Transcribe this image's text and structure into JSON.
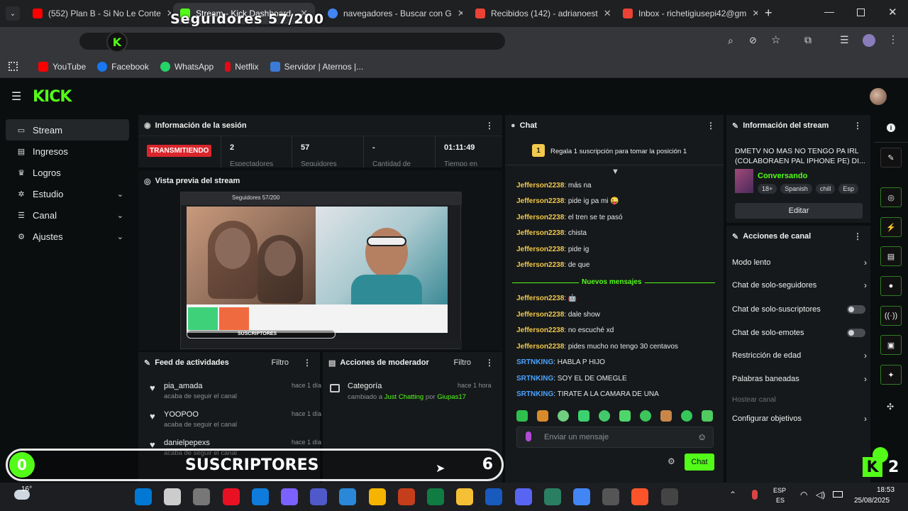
{
  "browser": {
    "tabs": [
      {
        "label": "(552) Plan B - Si No Le Conte",
        "color": "#ff0000"
      },
      {
        "label": "Stream - Kick Dashboard",
        "color": "#53fc18"
      },
      {
        "label": "navegadores - Buscar con G",
        "color": "#4285f4"
      },
      {
        "label": "Recibidos (142) - adrianoest",
        "color": "#ea4335"
      },
      {
        "label": "Inbox - richetigiusepi42@gm",
        "color": "#ea4335"
      }
    ],
    "bookmarks": [
      {
        "label": "YouTube",
        "color": "#ff0000"
      },
      {
        "label": "Facebook",
        "color": "#1877f2"
      },
      {
        "label": "WhatsApp",
        "color": "#25d366"
      },
      {
        "label": "Netflix",
        "color": "#e50914"
      },
      {
        "label": "Servidor | Aternos |...",
        "color": "#3b7bd8"
      }
    ]
  },
  "overlay": {
    "followers": "Seguidores 57/200",
    "subs_label": "SUSCRIPTORES",
    "subs_current": "0",
    "subs_goal": "6",
    "kick_count": "2"
  },
  "kick": {
    "logo": "KICK",
    "sidebar": [
      {
        "label": "Stream",
        "icon": "▭"
      },
      {
        "label": "Ingresos",
        "icon": "▤"
      },
      {
        "label": "Logros",
        "icon": "🏆"
      },
      {
        "label": "Estudio",
        "icon": "⚙"
      },
      {
        "label": "Canal",
        "icon": "☰"
      },
      {
        "label": "Ajustes",
        "icon": "⚙"
      }
    ],
    "session": {
      "title": "Información de la sesión",
      "live": "TRANSMITIENDO",
      "stats": [
        {
          "value": "2",
          "label": "Espectadores"
        },
        {
          "value": "57",
          "label": "Seguidores"
        },
        {
          "value": "-",
          "label": "Cantidad de"
        },
        {
          "value": "01:11:49",
          "label": "Tiempo en"
        }
      ]
    },
    "preview_title": "Vista previa del stream",
    "preview_inner_title": "Seguidores 57/200",
    "preview_subs": "SUSCRIPTORES",
    "feed": {
      "title": "Feed de actividades",
      "filter": "Filtro",
      "items": [
        {
          "name": "pia_amada",
          "sub": "acaba de seguir el canal",
          "time": "hace 1 día"
        },
        {
          "name": "YOOPOO",
          "sub": "acaba de seguir el canal",
          "time": "hace 1 día"
        },
        {
          "name": "danielpepexs",
          "sub": "acaba de seguir el canal",
          "time": "hace 1 día"
        }
      ]
    },
    "mod": {
      "title": "Acciones de moderador",
      "filter": "Filtro",
      "item": {
        "name": "Categoría",
        "pre": "cambiado a",
        "cat": "Just Chatting",
        "by": "por",
        "user": "Giupas17",
        "time": "hace 1 hora"
      }
    },
    "chat": {
      "title": "Chat",
      "promo": "Regala 1 suscripción para tomar la posición 1",
      "messages": [
        {
          "user": "Jefferson2238",
          "text": "más na"
        },
        {
          "user": "Jefferson2238",
          "text": "pide ig pa mi 😜"
        },
        {
          "user": "Jefferson2238",
          "text": "el tren se te pasó"
        },
        {
          "user": "Jefferson2238",
          "text": "chista"
        },
        {
          "user": "Jefferson2238",
          "text": "pide ig"
        },
        {
          "user": "Jefferson2238",
          "text": "de que"
        }
      ],
      "new_label": "Nuevos mensajes",
      "messages2": [
        {
          "user": "Jefferson2238",
          "text": "🤖",
          "blue": false
        },
        {
          "user": "Jefferson2238",
          "text": "dale show",
          "blue": false
        },
        {
          "user": "Jefferson2238",
          "text": "no escuché xd",
          "blue": false
        },
        {
          "user": "Jefferson2238",
          "text": "pides mucho no tengo 30 centavos",
          "blue": false
        },
        {
          "user": "SRTNKING",
          "text": "HABLA P HIJO",
          "blue": true
        },
        {
          "user": "SRTNKING",
          "text": "SOY EL DE OMEGLE",
          "blue": true
        },
        {
          "user": "SRTNKING",
          "text": "TIRATE A LA CAMARA DE UNA",
          "blue": true
        }
      ],
      "placeholder": "Enviar un mensaje",
      "send": "Chat"
    },
    "stream_info": {
      "title": "Información del stream",
      "stream_title": "DMETV NO MAS NO TENGO PA IRL (COLABORAEN PAL IPHONE PE) DI...",
      "category": "Conversando",
      "tags": [
        "18+",
        "Spanish",
        "chill",
        "Esp"
      ],
      "edit": "Editar"
    },
    "channel_actions": {
      "title": "Acciones de canal",
      "items": [
        {
          "label": "Modo lento",
          "kind": "chev"
        },
        {
          "label": "Chat de solo-seguidores",
          "kind": "chev"
        },
        {
          "label": "Chat de solo-suscriptores",
          "kind": "toggle"
        },
        {
          "label": "Chat de solo-emotes",
          "kind": "toggle"
        },
        {
          "label": "Restricción de edad",
          "kind": "chev"
        },
        {
          "label": "Palabras baneadas",
          "kind": "chev"
        },
        {
          "label": "Hostear canal",
          "kind": "disabled"
        },
        {
          "label": "Configurar objetivos",
          "kind": "chev"
        }
      ]
    }
  },
  "taskbar": {
    "weather": "16°",
    "lang1": "ESP",
    "lang2": "ES",
    "time": "18:53",
    "date": "25/08/2025",
    "icons": [
      "#0078d4",
      "#cccccc",
      "#777777",
      "#e81123",
      "#0f7bdc",
      "#7b61ff",
      "#5059c9",
      "#2b88d8",
      "#f4b400",
      "#c43e1c",
      "#107c41",
      "#f5c036",
      "#185abd",
      "#5865f2",
      "#2a7f62",
      "#4285f4",
      "#555555",
      "#fb542b",
      "#444444"
    ]
  }
}
